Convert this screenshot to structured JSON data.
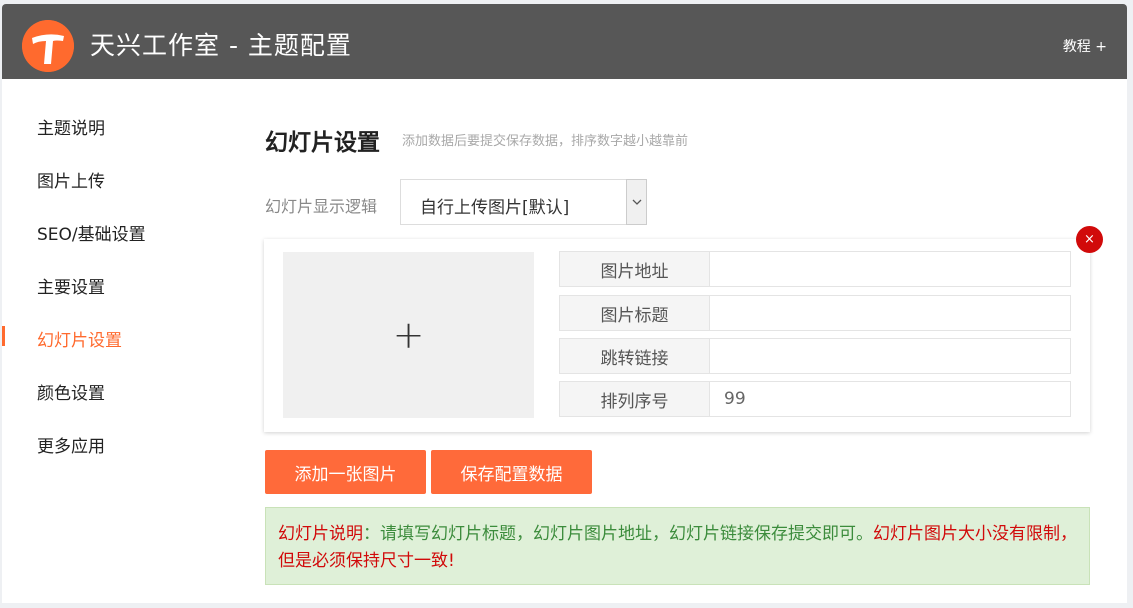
{
  "header": {
    "title": "天兴工作室 - 主题配置",
    "menu_right": "教程 +"
  },
  "sidebar": {
    "items": [
      {
        "label": "主题说明"
      },
      {
        "label": "图片上传"
      },
      {
        "label": "SEO/基础设置"
      },
      {
        "label": "主要设置"
      },
      {
        "label": "幻灯片设置"
      },
      {
        "label": "颜色设置"
      },
      {
        "label": "更多应用"
      }
    ],
    "active_item": "幻灯片设置"
  },
  "main": {
    "title": "幻灯片设置",
    "hint": "添加数据后要提交保存数据，排序数字越小越靠前",
    "display_logic_label": "幻灯片显示逻辑",
    "display_logic_value": "自行上传图片[默认]",
    "slide": {
      "delete_glyph": "×",
      "upload_glyph": "+",
      "fields": [
        {
          "label": "图片地址",
          "value": ""
        },
        {
          "label": "图片标题",
          "value": ""
        },
        {
          "label": "跳转链接",
          "value": ""
        },
        {
          "label": "排列序号",
          "value": "99"
        }
      ]
    },
    "buttons": {
      "add": "添加一张图片",
      "save": "保存配置数据"
    },
    "note": {
      "prefix": "幻灯片说明",
      "body": "：请填写幻灯片标题，幻灯片图片地址，幻灯片链接保存提交即可。",
      "warning": "幻灯片图片大小没有限制，但是必须保持尺寸一致!"
    }
  },
  "colors": {
    "accent": "#ff6a2e",
    "header_bg": "#575757",
    "danger": "#d10a0a",
    "note_bg": "#dff0d8"
  }
}
